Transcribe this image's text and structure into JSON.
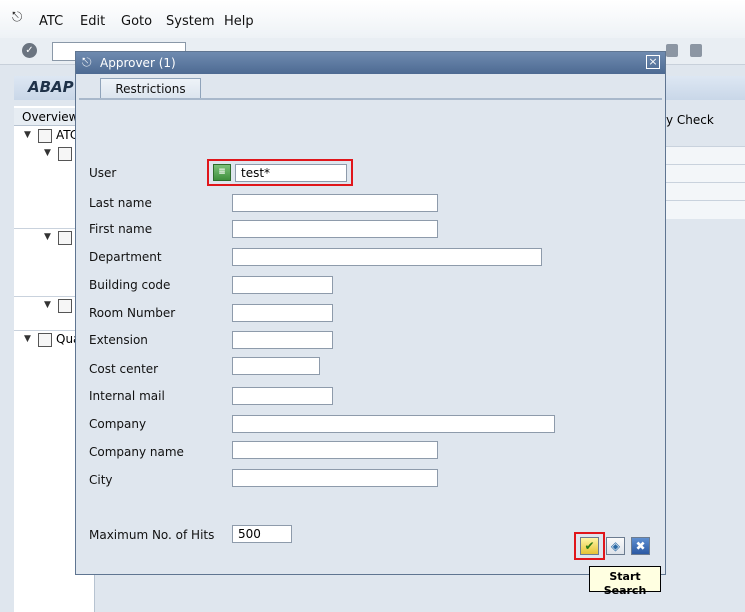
{
  "menu": {
    "items": [
      {
        "label": "ATC"
      },
      {
        "label": "Edit"
      },
      {
        "label": "Goto"
      },
      {
        "label": "System"
      },
      {
        "label": "Help"
      }
    ]
  },
  "background": {
    "title": "ABAP",
    "tree_header": "Overview",
    "tree_items": [
      "ATC",
      "Qua"
    ],
    "grid_header": "y Check"
  },
  "dialog": {
    "title": "Approver (1)",
    "close_symbol": "×",
    "tab_label": "Restrictions",
    "fields": {
      "user": {
        "label": "User",
        "value": "test*"
      },
      "last_name": {
        "label": "Last name",
        "value": ""
      },
      "first_name": {
        "label": "First name",
        "value": ""
      },
      "department": {
        "label": "Department",
        "value": ""
      },
      "building_code": {
        "label": "Building code",
        "value": ""
      },
      "room_number": {
        "label": "Room Number",
        "value": ""
      },
      "extension": {
        "label": "Extension",
        "value": ""
      },
      "cost_center": {
        "label": "Cost center",
        "value": ""
      },
      "internal_mail": {
        "label": "Internal mail",
        "value": ""
      },
      "company": {
        "label": "Company",
        "value": ""
      },
      "company_name": {
        "label": "Company name",
        "value": ""
      },
      "city": {
        "label": "City",
        "value": ""
      },
      "max_hits": {
        "label": "Maximum No. of Hits",
        "value": "500"
      }
    },
    "buttons": {
      "start_search_icon": "check-icon",
      "multiple_selection_icon": "multiple-selection-icon",
      "cancel_icon": "cancel-icon"
    }
  },
  "tooltip": {
    "text": "Start Search"
  },
  "colors": {
    "highlight": "#e0161b",
    "dialog_title_bar": "#5a7699",
    "tooltip_bg": "#ffffe1"
  }
}
